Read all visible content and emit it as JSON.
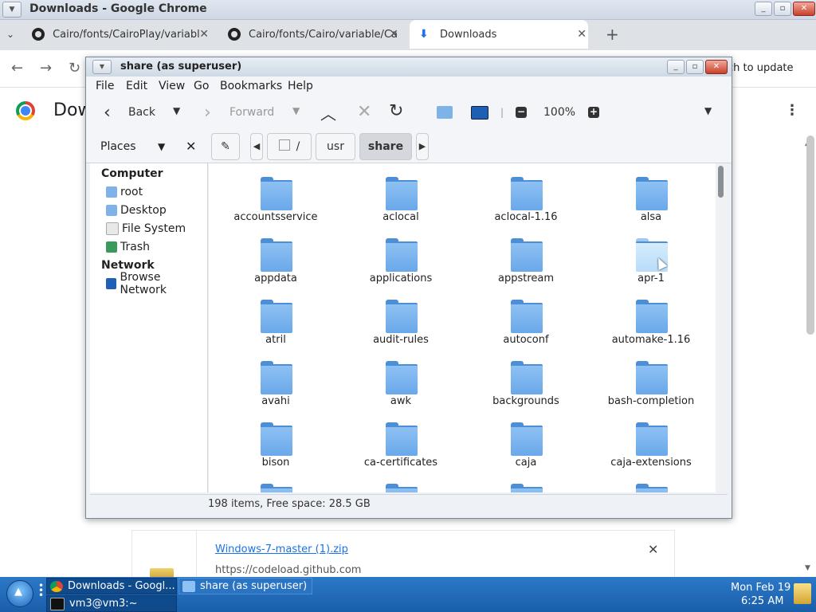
{
  "chrome": {
    "window_title": "Downloads - Google Chrome",
    "tabs": [
      {
        "label": "Cairo/fonts/CairoPlay/variabl",
        "icon": "github-icon"
      },
      {
        "label": "Cairo/fonts/Cairo/variable/Ca",
        "icon": "github-icon"
      },
      {
        "label": "Downloads",
        "icon": "download-icon"
      }
    ],
    "update_label": "ch to update",
    "page_heading": "Dow",
    "download_item": {
      "filename": "Windows-7-master (1).zip",
      "url": "https://codeload.github.com"
    }
  },
  "caja": {
    "window_title": "share (as superuser)",
    "menus": [
      "File",
      "Edit",
      "View",
      "Go",
      "Bookmarks",
      "Help"
    ],
    "toolbar": {
      "back": "Back",
      "forward": "Forward",
      "zoom": "100%"
    },
    "places_label": "Places",
    "path": [
      "/",
      "usr",
      "share"
    ],
    "sidebar": {
      "computer_heading": "Computer",
      "computer_items": [
        "root",
        "Desktop",
        "File System",
        "Trash"
      ],
      "network_heading": "Network",
      "network_items": [
        "Browse Network"
      ]
    },
    "folders": [
      "accountsservice",
      "aclocal",
      "aclocal-1.16",
      "alsa",
      "appdata",
      "applications",
      "appstream",
      "apr-1",
      "atril",
      "audit-rules",
      "autoconf",
      "automake-1.16",
      "avahi",
      "awk",
      "backgrounds",
      "bash-completion",
      "bison",
      "ca-certificates",
      "caja",
      "caja-extensions"
    ],
    "hovered_folder": "apr-1",
    "status": "198 items, Free space: 28.5 GB"
  },
  "taskbar": {
    "tasks": [
      {
        "label": "Downloads - Googl...",
        "active": true
      },
      {
        "label": "share (as superuser)",
        "active": false
      },
      {
        "label": "vm3@vm3:~",
        "active": false
      }
    ],
    "date": "Mon Feb 19",
    "time": "6:25 AM"
  }
}
